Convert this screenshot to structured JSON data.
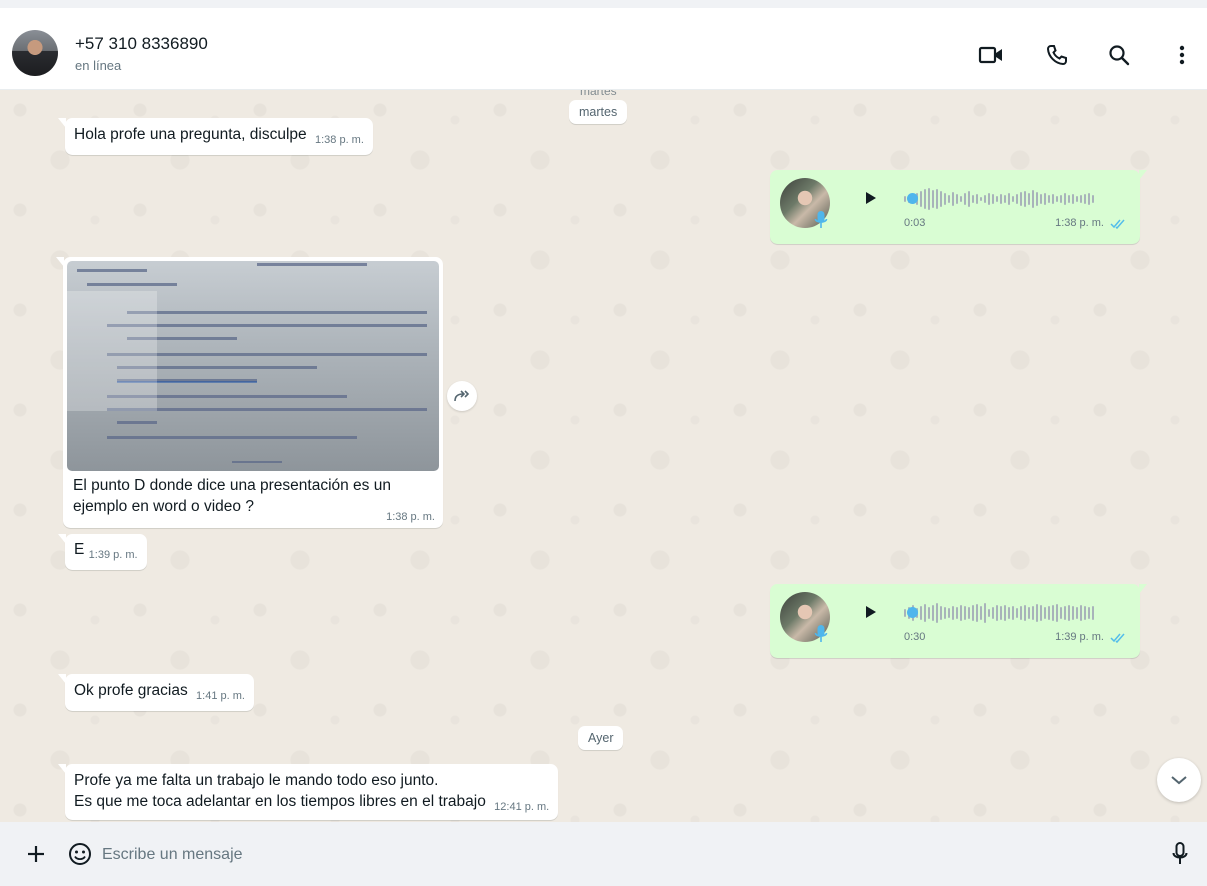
{
  "header": {
    "contact_name": "+57 310 8336890",
    "status": "en línea",
    "icons": [
      "video-call-icon",
      "voice-call-icon",
      "search-icon",
      "menu-icon"
    ]
  },
  "chat": {
    "date_ghost": "martes",
    "date_martes": "martes",
    "date_ayer": "Ayer",
    "messages": [
      {
        "dir": "in",
        "text": "Hola profe una pregunta, disculpe",
        "time": "1:38 p. m."
      },
      {
        "dir": "out",
        "type": "voice",
        "duration": "0:03",
        "time": "1:38 p. m.",
        "status": "read"
      },
      {
        "dir": "in",
        "type": "image",
        "caption_line1": "El punto D donde dice una presentación es un",
        "caption_line2": "ejemplo en word o video ?",
        "time": "1:38 p. m."
      },
      {
        "dir": "in",
        "text": "E",
        "time": "1:39 p. m."
      },
      {
        "dir": "out",
        "type": "voice",
        "duration": "0:30",
        "time": "1:39 p. m.",
        "status": "read"
      },
      {
        "dir": "in",
        "text": "Ok profe gracias",
        "time": "1:41 p. m."
      },
      {
        "dir": "in",
        "text_line1": "Profe ya me falta un trabajo le mando todo eso junto.",
        "text_line2": "Es que me toca adelantar en los tiempos libres en el trabajo",
        "time": "12:41 p. m."
      }
    ]
  },
  "footer": {
    "input_placeholder": "Escribe un mensaje",
    "icons": [
      "plus-icon",
      "emoji-icon",
      "mic-icon"
    ]
  },
  "colors": {
    "chat_bg": "#efeae2",
    "incoming_bubble": "#ffffff",
    "outgoing_bubble": "#d9fdd3",
    "read_ticks": "#53bdeb",
    "voice_dot": "#4fb6ec"
  }
}
